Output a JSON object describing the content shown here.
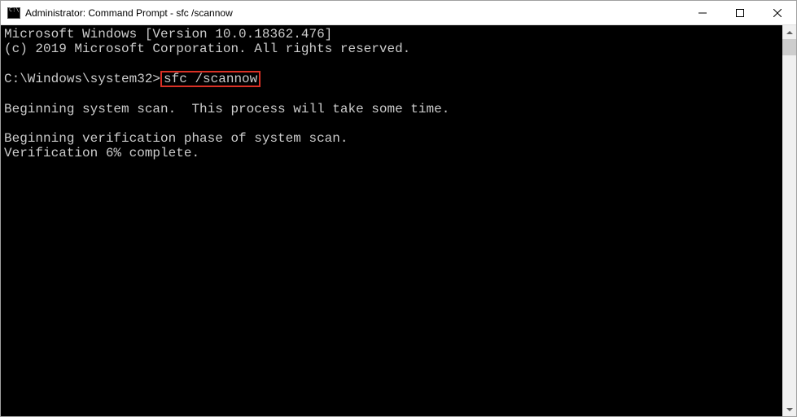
{
  "window": {
    "title": "Administrator: Command Prompt - sfc  /scannow"
  },
  "terminal": {
    "line1": "Microsoft Windows [Version 10.0.18362.476]",
    "line2": "(c) 2019 Microsoft Corporation. All rights reserved.",
    "blank1": "",
    "prompt_prefix": "C:\\Windows\\system32>",
    "command": "sfc /scannow",
    "blank2": "",
    "line3": "Beginning system scan.  This process will take some time.",
    "blank3": "",
    "line4": "Beginning verification phase of system scan.",
    "line5": "Verification 6% complete."
  }
}
